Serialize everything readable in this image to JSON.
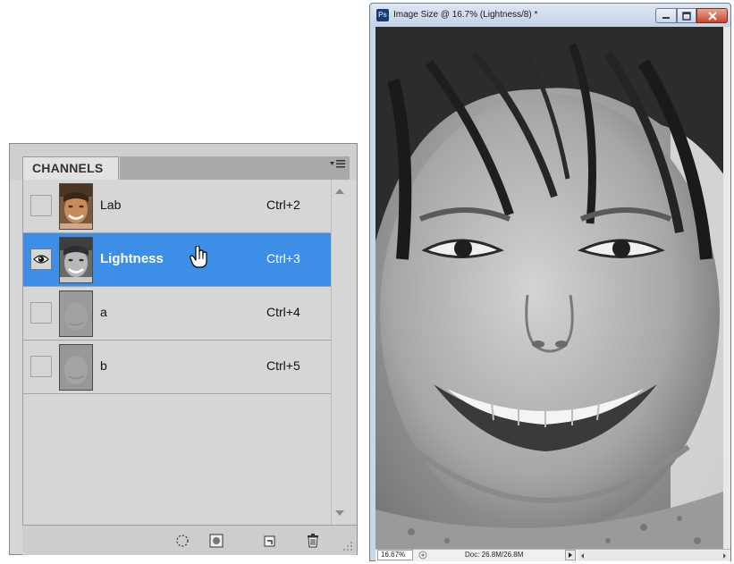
{
  "channels_panel": {
    "tab_label": "CHANNELS",
    "menu_icon": "panel-menu-icon",
    "channels": [
      {
        "name": "Lab",
        "shortcut": "Ctrl+2",
        "visible": false,
        "selected": false,
        "thumbnail": "color-face-thumbnail"
      },
      {
        "name": "Lightness",
        "shortcut": "Ctrl+3",
        "visible": true,
        "selected": true,
        "thumbnail": "grayscale-face-thumbnail"
      },
      {
        "name": "a",
        "shortcut": "Ctrl+4",
        "visible": false,
        "selected": false,
        "thumbnail": "flat-gray-thumbnail"
      },
      {
        "name": "b",
        "shortcut": "Ctrl+5",
        "visible": false,
        "selected": false,
        "thumbnail": "flat-gray-thumbnail"
      }
    ],
    "footer_buttons": [
      "load-channel-as-selection-icon",
      "save-selection-as-channel-icon",
      "new-channel-icon",
      "delete-channel-icon"
    ],
    "selection_color": "#3d8ee6"
  },
  "document_window": {
    "title": "Image Size @ 16.7% (Lightness/8) *",
    "app_icon_label": "Ps",
    "controls": [
      "minimize-icon",
      "maximize-icon",
      "close-icon"
    ],
    "status": {
      "zoom": "16.67%",
      "doc_info": "Doc: 26.8M/26.8M"
    }
  }
}
